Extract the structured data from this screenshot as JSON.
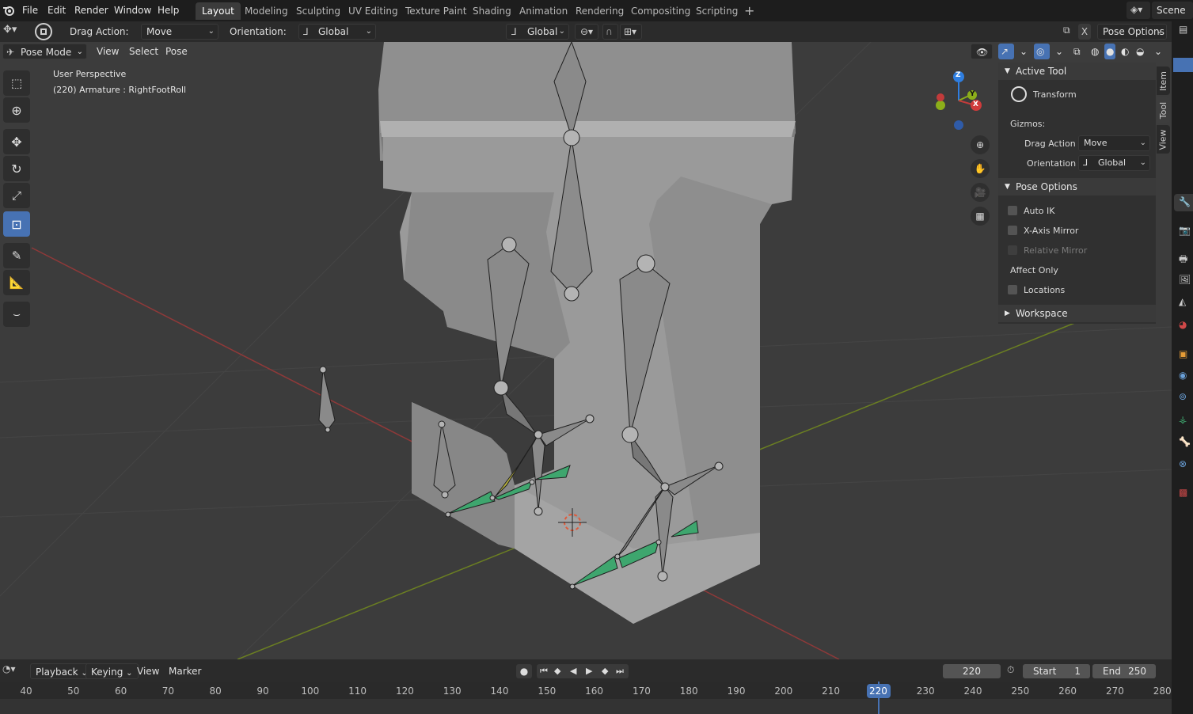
{
  "topbar": {
    "menu": [
      "File",
      "Edit",
      "Render",
      "Window",
      "Help"
    ],
    "workspaces": [
      "Layout",
      "Modeling",
      "Sculpting",
      "UV Editing",
      "Texture Paint",
      "Shading",
      "Animation",
      "Rendering",
      "Compositing",
      "Scripting"
    ],
    "active_workspace": "Layout",
    "add_tab": "+",
    "scene": "Scene"
  },
  "toolheader": {
    "drag_action_label": "Drag Action:",
    "drag_action_value": "Move",
    "orientation_label": "Orientation:",
    "orientation_value": "Global",
    "transform_orientation": "Global",
    "pose_options": "Pose Options",
    "x_label": "X"
  },
  "viewport_header": {
    "mode": "Pose Mode",
    "menus": [
      "View",
      "Select",
      "Pose"
    ]
  },
  "viewport": {
    "perspective": "User Perspective",
    "info": "(220) Armature : RightFootRoll"
  },
  "gizmo": {
    "z": "Z",
    "y": "Y",
    "x": "X"
  },
  "npanel": {
    "active_tool_title": "Active Tool",
    "tool_name": "Transform",
    "gizmos_label": "Gizmos:",
    "drag_action_label": "Drag Action",
    "drag_action_value": "Move",
    "orientation_label": "Orientation",
    "orientation_value": "Global",
    "pose_options_title": "Pose Options",
    "auto_ik": "Auto IK",
    "x_axis_mirror": "X-Axis Mirror",
    "relative_mirror": "Relative Mirror",
    "affect_only": "Affect Only",
    "locations": "Locations",
    "workspace_title": "Workspace",
    "tabs": [
      "Item",
      "Tool",
      "View"
    ]
  },
  "timeline": {
    "menus": [
      "Playback",
      "Keying",
      "View",
      "Marker"
    ],
    "current_frame": "220",
    "start_label": "Start",
    "start_value": "1",
    "end_label": "End",
    "end_value": "250",
    "ruler": [
      "40",
      "50",
      "60",
      "70",
      "80",
      "90",
      "100",
      "110",
      "120",
      "130",
      "140",
      "150",
      "160",
      "170",
      "180",
      "190",
      "200",
      "210",
      "220",
      "230",
      "240",
      "250",
      "260",
      "270",
      "280"
    ]
  },
  "colors": {
    "accent": "#4772b3",
    "x_axis": "#c23b3b",
    "y_axis": "#8cae1a",
    "z_axis": "#2f7ee0",
    "selected_bone": "#3ea66e"
  }
}
